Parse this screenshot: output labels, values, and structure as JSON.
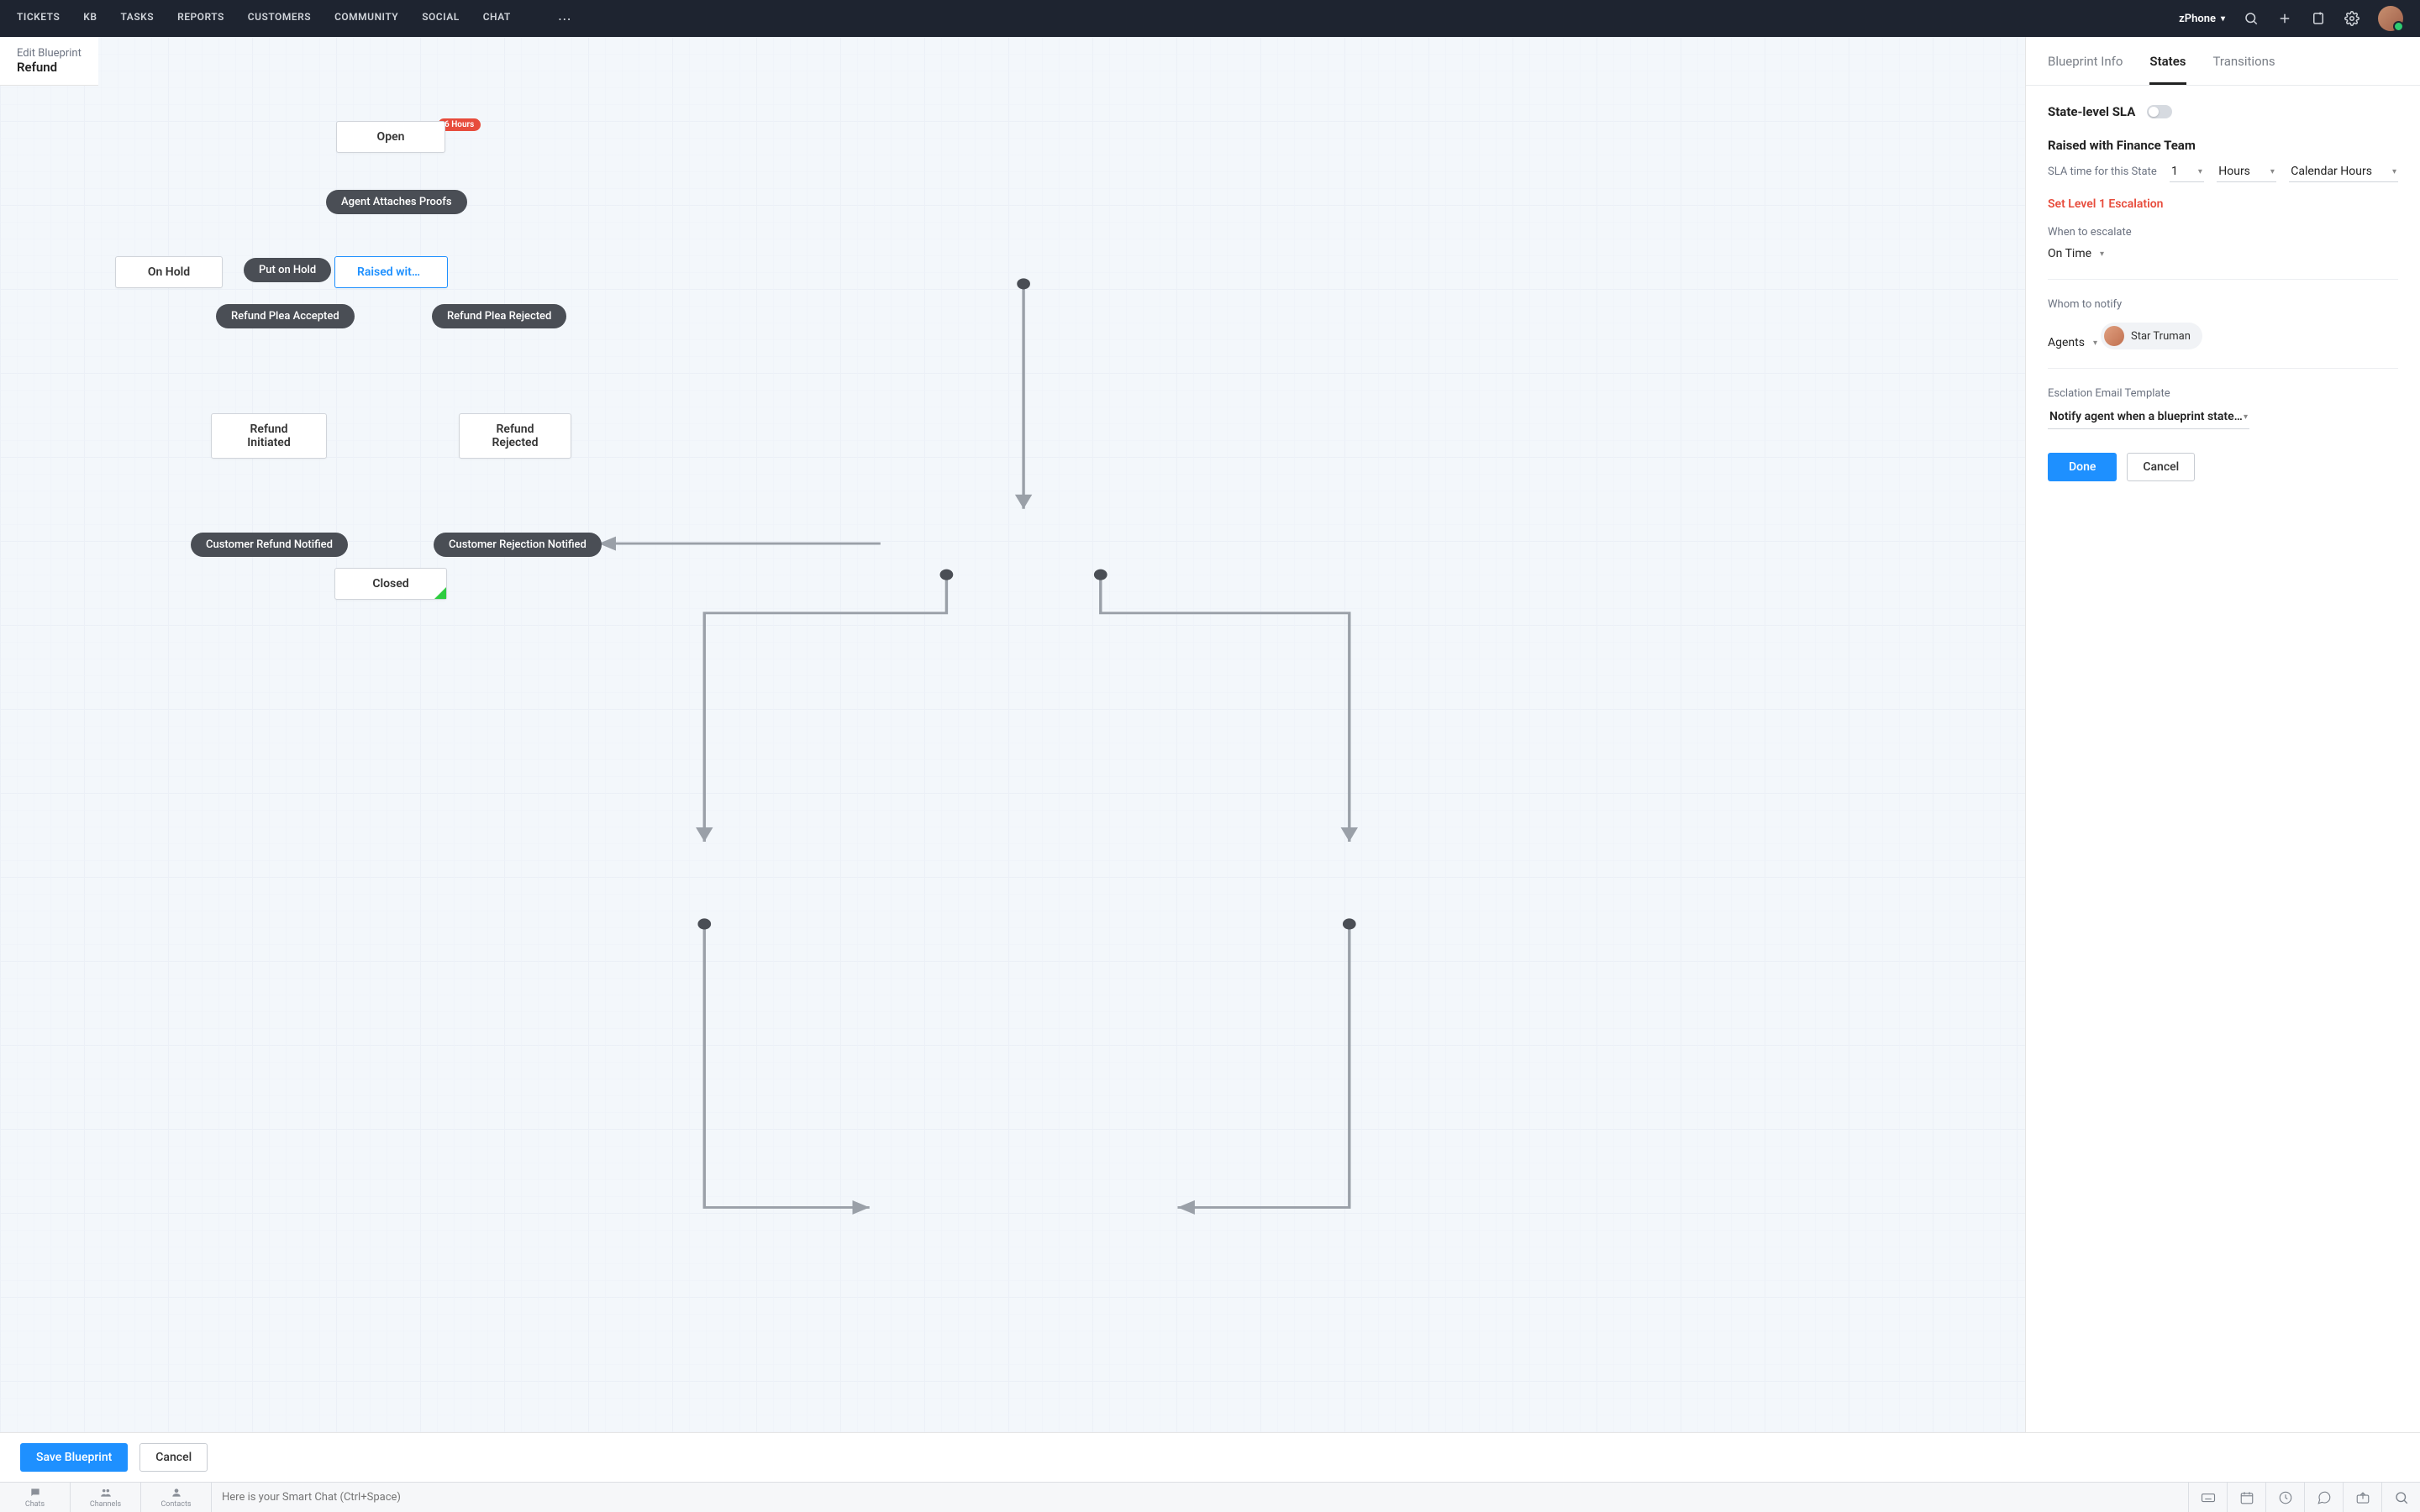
{
  "nav": {
    "items": [
      "TICKETS",
      "KB",
      "TASKS",
      "REPORTS",
      "CUSTOMERS",
      "COMMUNITY",
      "SOCIAL",
      "CHAT"
    ],
    "phone_label": "zPhone"
  },
  "canvas": {
    "edit_label": "Edit Blueprint",
    "name": "Refund",
    "badge_open": "6 Hours",
    "nodes": {
      "open": "Open",
      "on_hold": "On Hold",
      "raised_fin": "Raised with Fin...",
      "refund_initiated": "Refund Initiated",
      "refund_rejected": "Refund Rejected",
      "closed": "Closed"
    },
    "transitions": {
      "agent_attaches": "Agent Attaches Proofs",
      "put_on_hold": "Put on Hold",
      "plea_accepted": "Refund Plea Accepted",
      "plea_rejected": "Refund Plea Rejected",
      "cust_refund_notified": "Customer Refund Notified",
      "cust_reject_notified": "Customer Rejection Notified"
    },
    "save_label": "Save Blueprint",
    "cancel_label": "Cancel"
  },
  "panel": {
    "tabs": {
      "info": "Blueprint Info",
      "states": "States",
      "transitions": "Transitions"
    },
    "sla_label": "State-level SLA",
    "state_name": "Raised with Finance Team",
    "sla_time_label": "SLA time for this State",
    "sla_value": "1",
    "sla_unit": "Hours",
    "sla_calendar": "Calendar Hours",
    "escalation_title": "Set Level 1 Escalation",
    "when_label": "When to escalate",
    "when_value": "On Time",
    "whom_label": "Whom to notify",
    "whom_value": "Agents",
    "agent_name": "Star Truman",
    "template_label": "Esclation Email Template",
    "template_value": "Notify agent when a blueprint state i...",
    "done_label": "Done",
    "cancel_label": "Cancel"
  },
  "bottombar": {
    "tabs": {
      "chats": "Chats",
      "channels": "Channels",
      "contacts": "Contacts"
    },
    "placeholder": "Here is your Smart Chat (Ctrl+Space)"
  }
}
